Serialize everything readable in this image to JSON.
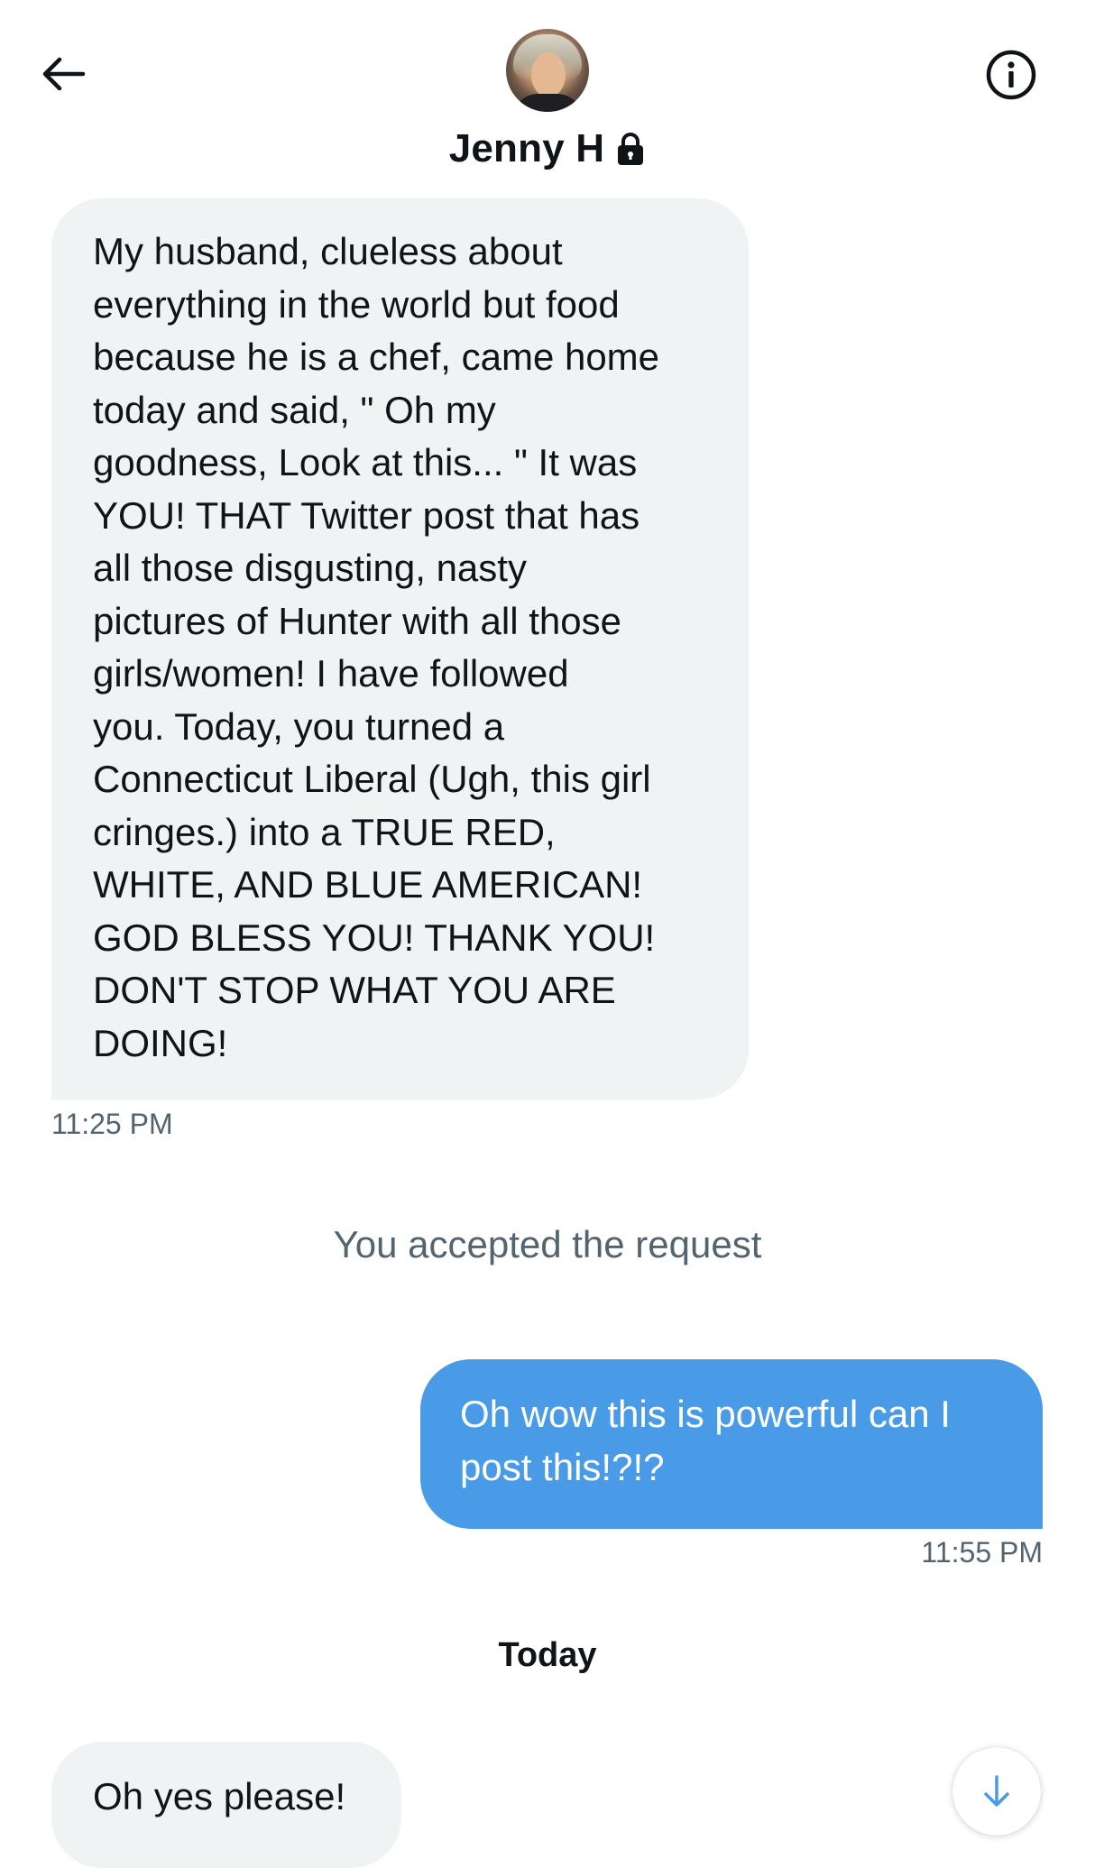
{
  "header": {
    "contact_name": "Jenny H",
    "back_icon": "arrow-left-icon",
    "info_icon": "info-circle-icon",
    "lock_icon": "lock-icon"
  },
  "messages": [
    {
      "direction": "incoming",
      "text": "My husband, clueless about\neverything in the world but food\nbecause he is a chef, came home\ntoday and said, \" Oh my\ngoodness, Look at this... \"  It was\nYOU!  THAT Twitter post that has\nall those disgusting, nasty\npictures of Hunter with all those\ngirls/women!  I have followed\nyou.  Today, you turned a\nConnecticut Liberal (Ugh, this girl\ncringes.) into a TRUE RED,\nWHITE, AND BLUE AMERICAN!\nGOD BLESS YOU!  THANK YOU!\nDON'T STOP WHAT YOU ARE\nDOING!",
      "time": "11:25 PM"
    },
    {
      "direction": "system",
      "text": "You accepted the request"
    },
    {
      "direction": "outgoing",
      "text": "Oh wow this is powerful can I\npost this!?!?",
      "time": "11:55 PM"
    },
    {
      "direction": "divider",
      "text": "Today"
    },
    {
      "direction": "incoming",
      "text": "Oh yes please!"
    }
  ],
  "scroll_button_icon": "arrow-down-icon",
  "colors": {
    "incoming_bubble": "#eff3f4",
    "outgoing_bubble": "#4a9be7",
    "secondary_text": "#536471",
    "primary_text": "#0f1419"
  }
}
